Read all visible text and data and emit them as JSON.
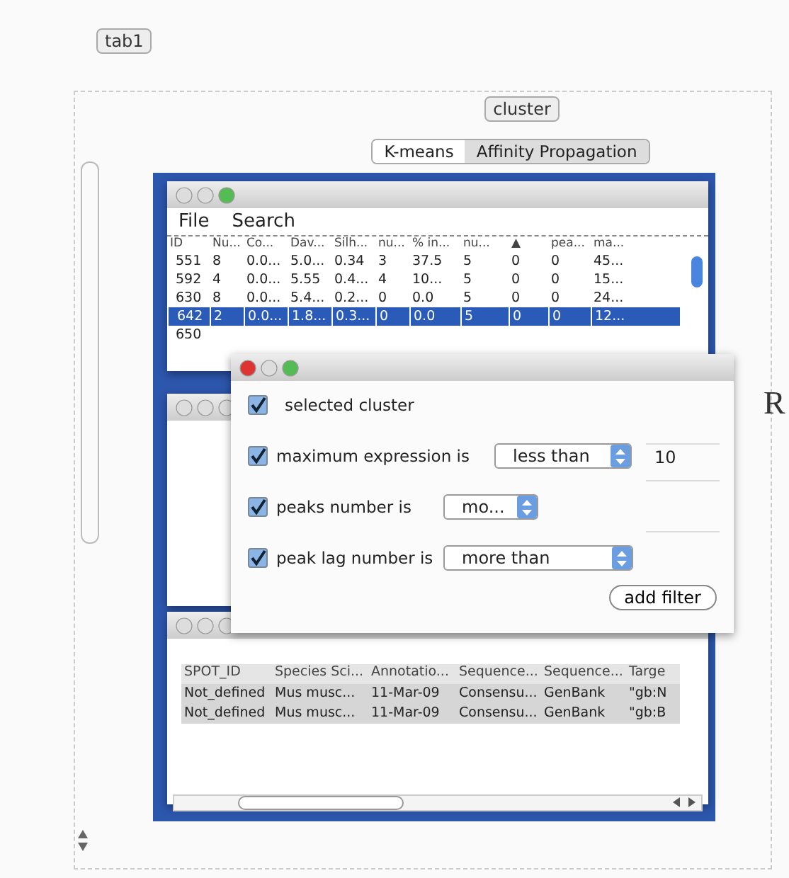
{
  "top_tab": {
    "label": "tab1"
  },
  "cluster_button": {
    "label": "cluster"
  },
  "methods": [
    {
      "label": "K-means",
      "selected": true
    },
    {
      "label": "Affinity Propagation",
      "selected": false
    }
  ],
  "cluster_window": {
    "menu": [
      "File",
      "Search"
    ],
    "columns": [
      "ID",
      "Nu...",
      "Co...",
      "Dav...",
      "Silh...",
      "nu...",
      "% in...",
      "nu...",
      "▲",
      "pea...",
      "ma..."
    ],
    "rows": [
      {
        "cells": [
          "551",
          "8",
          "0.0...",
          "5.0...",
          "0.34",
          "3",
          "37.5",
          "5",
          "0",
          "0",
          "45..."
        ],
        "selected": false
      },
      {
        "cells": [
          "592",
          "4",
          "0.0...",
          "5.55",
          "0.4...",
          "4",
          "10...",
          "5",
          "0",
          "0",
          "15..."
        ],
        "selected": false
      },
      {
        "cells": [
          "630",
          "8",
          "0.0...",
          "5.4...",
          "0.2...",
          "0",
          "0.0",
          "5",
          "0",
          "0",
          "24..."
        ],
        "selected": false
      },
      {
        "cells": [
          "642",
          "2",
          "0.0...",
          "1.8...",
          "0.3...",
          "0",
          "0.0",
          "5",
          "0",
          "0",
          "12..."
        ],
        "selected": true
      },
      {
        "cells": [
          "650"
        ],
        "selected": false
      }
    ]
  },
  "filter_dialog": {
    "filters": [
      {
        "kind": "flag",
        "label": "selected cluster",
        "checked": true
      },
      {
        "kind": "condition",
        "label": "maximum expression is",
        "checked": true,
        "operator": "less than",
        "value": "10"
      },
      {
        "kind": "condition",
        "label": "peaks number is",
        "checked": true,
        "operator": "mo..."
      },
      {
        "kind": "condition",
        "label": "peak lag number is",
        "checked": true,
        "operator": "more than"
      }
    ],
    "button": "add filter"
  },
  "annotation_window": {
    "columns": [
      "SPOT_ID",
      "Species Sci...",
      "Annotatio...",
      "Sequence...",
      "Sequence...",
      "Targe"
    ],
    "rows": [
      {
        "cells": [
          "Not_defined",
          "Mus musc...",
          "11-Mar-09",
          "Consensu...",
          "GenBank",
          "\"gb:N"
        ],
        "selected": true
      },
      {
        "cells": [
          "Not_defined",
          "Mus musc...",
          "11-Mar-09",
          "Consensu...",
          "GenBank",
          "\"gb:B"
        ],
        "selected": true
      }
    ]
  },
  "margin_text": "R"
}
